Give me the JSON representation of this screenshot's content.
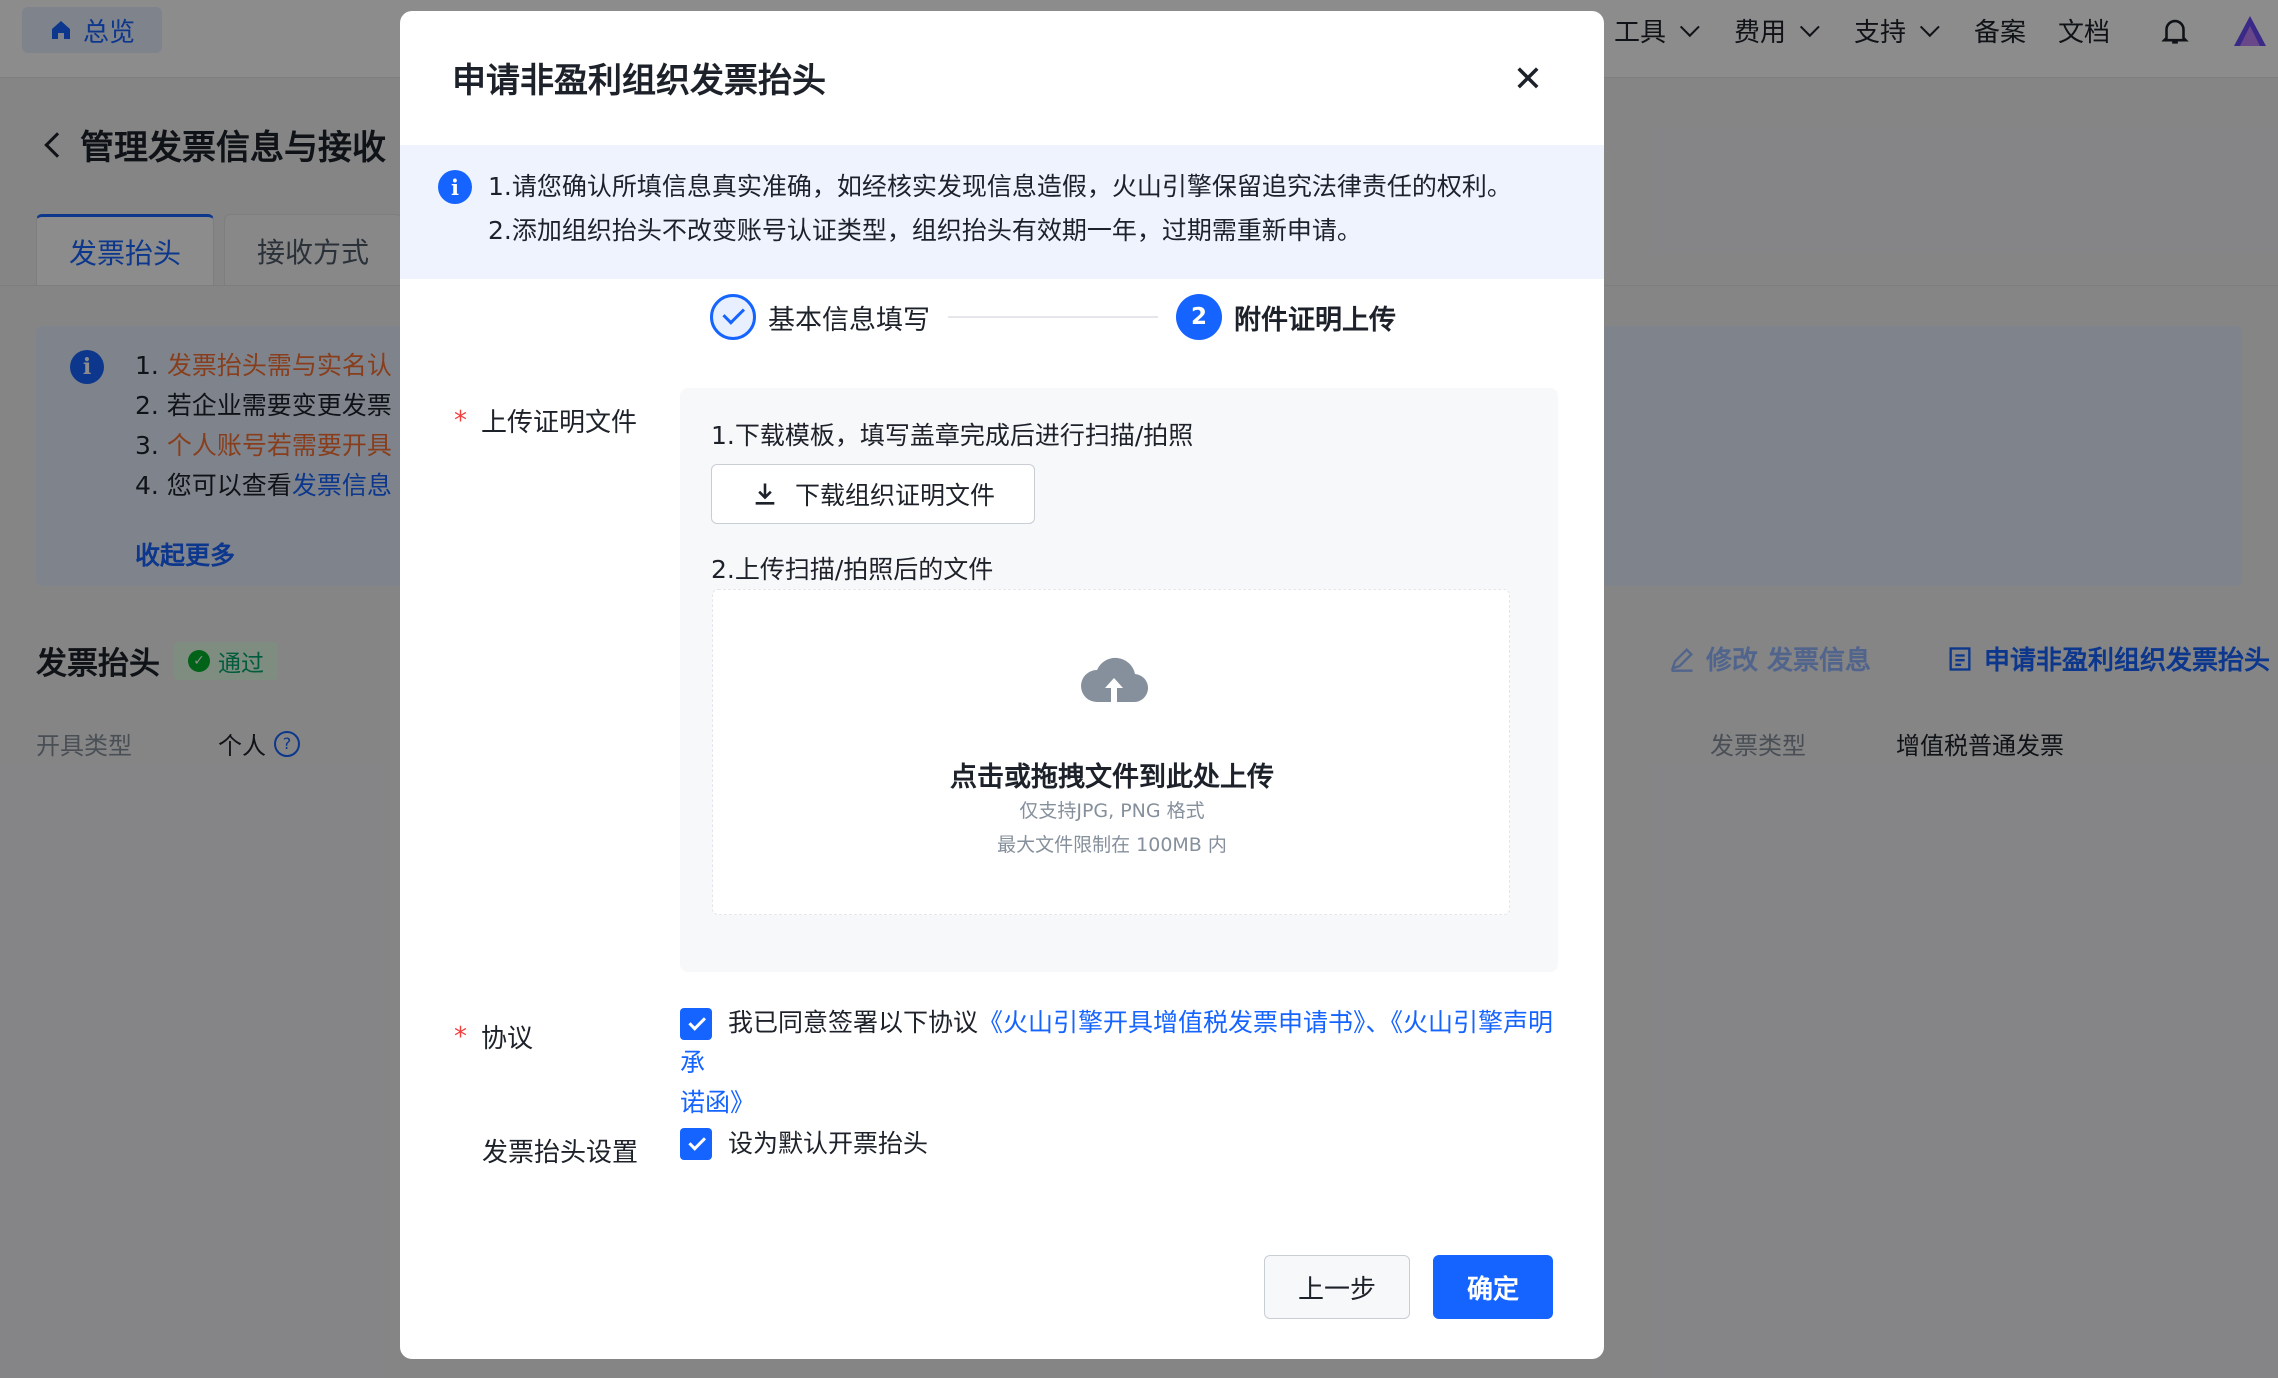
{
  "background": {
    "nav": {
      "home_label": "总览",
      "items": [
        {
          "label": "工具"
        },
        {
          "label": "费用"
        },
        {
          "label": "支持"
        },
        {
          "label": "备案"
        },
        {
          "label": "文档"
        }
      ]
    },
    "page_title": "管理发票信息与接收",
    "tabs": [
      "发票抬头",
      "接收方式"
    ],
    "notice": {
      "line1_prefix": "1. ",
      "line1_highlight": "发票抬头需与实名认",
      "line2": "2. 若企业需要变更发票",
      "line3_prefix": "3. ",
      "line3_highlight": "个人账号若需要开具",
      "line4_prefix": "4. 您可以查看",
      "line4_link": "发票信息",
      "collapse": "收起更多"
    },
    "section_title": "发票抬头",
    "status_badge": "通过",
    "issue_type_label": "开具类型",
    "issue_type_value": "个人",
    "edit_action": "修改 发票信息",
    "apply_action": "申请非盈利组织发票抬头",
    "invoice_type_label": "发票类型",
    "invoice_type_value": "增值税普通发票"
  },
  "modal": {
    "title": "申请非盈利组织发票抬头",
    "close_symbol": "✕",
    "alert": {
      "line1": "1.请您确认所填信息真实准确，如经核实发现信息造假，火山引擎保留追究法律责任的权利。",
      "line2": "2.添加组织抬头不改变账号认证类型，组织抬头有效期一年，过期需重新申请。"
    },
    "steps": [
      {
        "label": "基本信息填写",
        "number": "1",
        "status": "done"
      },
      {
        "label": "附件证明上传",
        "number": "2",
        "status": "current"
      }
    ],
    "upload": {
      "label": "上传证明文件",
      "step1": "1.下载模板，填写盖章完成后进行扫描/拍照",
      "download_button": "下载组织证明文件",
      "step2": "2.上传扫描/拍照后的文件",
      "dropzone_title": "点击或拖拽文件到此处上传",
      "dropzone_format": "仅支持JPG, PNG 格式",
      "dropzone_limit": "最大文件限制在 100MB 内"
    },
    "agreement": {
      "label": "协议",
      "checked": true,
      "text": "我已同意签署以下协议",
      "link1": "《火山引擎开具增值税发票申请书》",
      "separator": "、",
      "link2_part1": "《火山引擎声明承",
      "link2_part2": "诺函》"
    },
    "header_setting": {
      "label": "发票抬头设置",
      "checked": true,
      "text": "设为默认开票抬头"
    },
    "buttons": {
      "prev": "上一步",
      "confirm": "确定"
    }
  }
}
